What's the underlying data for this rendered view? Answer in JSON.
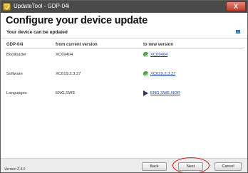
{
  "window": {
    "title": "UpdateTool - GDP-04i",
    "close_glyph": "X"
  },
  "header": {
    "title": "Configure your device update",
    "subtitle": "Your device can be updated"
  },
  "table": {
    "device_header": "GDP-04i",
    "current_header": "from current version",
    "new_header": "to new version",
    "rows": [
      {
        "label": "Bootloader",
        "current": "XC69404",
        "new": "XC69404",
        "status_icon": "check-icon"
      },
      {
        "label": "Software",
        "current": "XC619.2.3.27",
        "new": "XC619.2.3.27",
        "status_icon": "check-icon"
      },
      {
        "label": "Languages",
        "current": "ENG,SWE",
        "new": "ENG,SWE,NOR",
        "status_icon": "arrow-right-icon"
      }
    ]
  },
  "footer": {
    "version": "Version 2.4.0",
    "back_label": "Back",
    "next_label": "Next",
    "cancel_label": "Cancel"
  },
  "colors": {
    "title_bar": "#4a4a4a",
    "link": "#1a3fb0",
    "ok": "#56b04a",
    "highlight": "#e01515"
  }
}
